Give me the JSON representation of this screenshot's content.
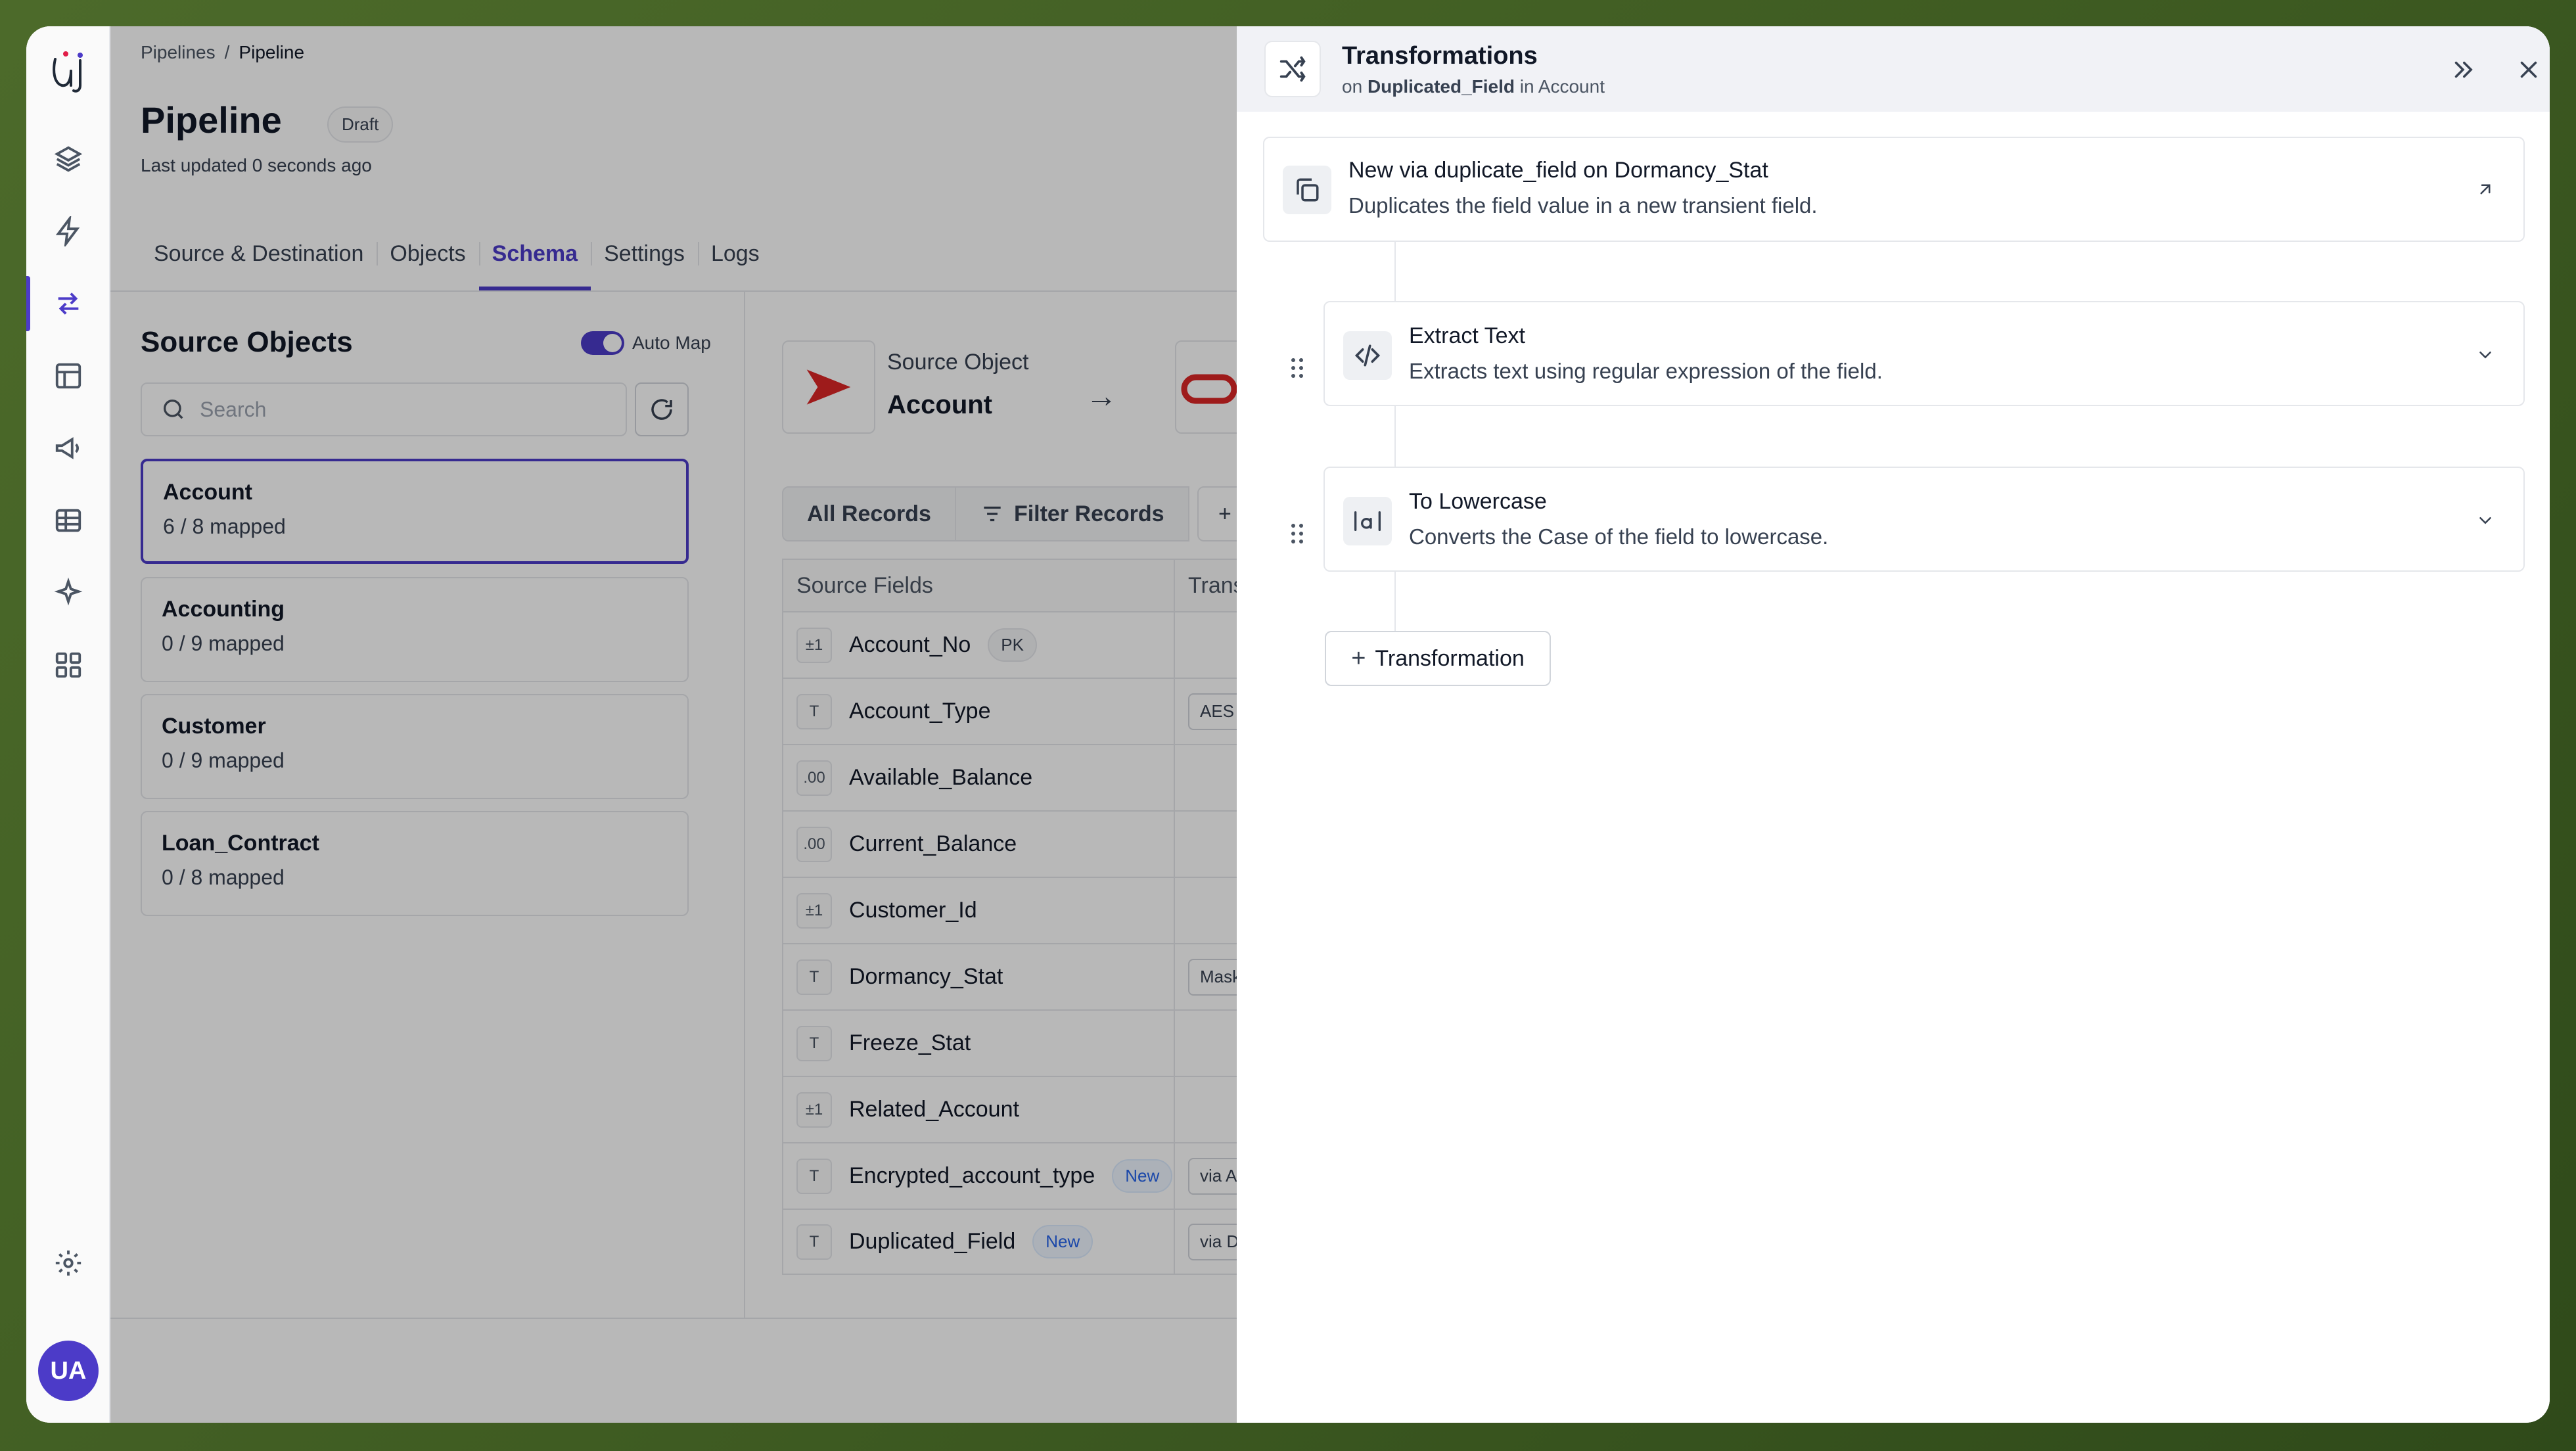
{
  "breadcrumb": {
    "parent": "Pipelines",
    "separator": "/",
    "current": "Pipeline"
  },
  "page": {
    "title": "Pipeline",
    "status": "Draft",
    "updated": "Last updated 0 seconds ago"
  },
  "tabs": [
    "Source & Destination",
    "Objects",
    "Schema",
    "Settings",
    "Logs"
  ],
  "active_tab": "Schema",
  "source_objects": {
    "heading": "Source Objects",
    "auto_map_label": "Auto Map",
    "search_placeholder": "Search",
    "items": [
      {
        "name": "Account",
        "mapped": "6 / 8 mapped"
      },
      {
        "name": "Accounting",
        "mapped": "0 / 9 mapped"
      },
      {
        "name": "Customer",
        "mapped": "0 / 9 mapped"
      },
      {
        "name": "Loan_Contract",
        "mapped": "0 / 8 mapped"
      }
    ]
  },
  "mapping": {
    "source_object_label": "Source Object",
    "source_object_value": "Account",
    "record_buttons": [
      "All Records",
      "Filter Records"
    ],
    "add_transform_label": "+ Tr",
    "columns": [
      "Source Fields",
      "Transfor"
    ],
    "fields": [
      {
        "type": "±1",
        "name": "Account_No",
        "badge": "PK",
        "transform": ""
      },
      {
        "type": "T",
        "name": "Account_Type",
        "badge": "",
        "transform": "AES E"
      },
      {
        "type": ".00",
        "name": "Available_Balance",
        "badge": "",
        "transform": ""
      },
      {
        "type": ".00",
        "name": "Current_Balance",
        "badge": "",
        "transform": ""
      },
      {
        "type": "±1",
        "name": "Customer_Id",
        "badge": "",
        "transform": ""
      },
      {
        "type": "T",
        "name": "Dormancy_Stat",
        "badge": "",
        "transform": "Mask"
      },
      {
        "type": "T",
        "name": "Freeze_Stat",
        "badge": "",
        "transform": ""
      },
      {
        "type": "±1",
        "name": "Related_Account",
        "badge": "",
        "transform": ""
      },
      {
        "type": "T",
        "name": "Encrypted_account_type",
        "badge": "New",
        "transform": "via Al"
      },
      {
        "type": "T",
        "name": "Duplicated_Field",
        "badge": "New",
        "transform": "via Du"
      }
    ]
  },
  "drawer": {
    "title": "Transformations",
    "subtitle_prefix": "on",
    "subtitle_field": "Duplicated_Field",
    "subtitle_mid": "in",
    "subtitle_object": "Account",
    "origin": {
      "prefix": "New via",
      "function": "duplicate_field",
      "mid": "on",
      "field": "Dormancy_Stat",
      "description": "Duplicates the field value in a new transient field."
    },
    "steps": [
      {
        "title": "Extract Text",
        "description": "Extracts text using regular expression of the field.",
        "icon": "code-icon"
      },
      {
        "title": "To Lowercase",
        "description": "Converts the Case of the field to lowercase.",
        "icon": "lowercase-icon"
      }
    ],
    "add_label": "Transformation"
  },
  "user": {
    "initials": "UA"
  },
  "colors": {
    "accent": "#4c3bc8",
    "new_badge": "#2563eb"
  }
}
